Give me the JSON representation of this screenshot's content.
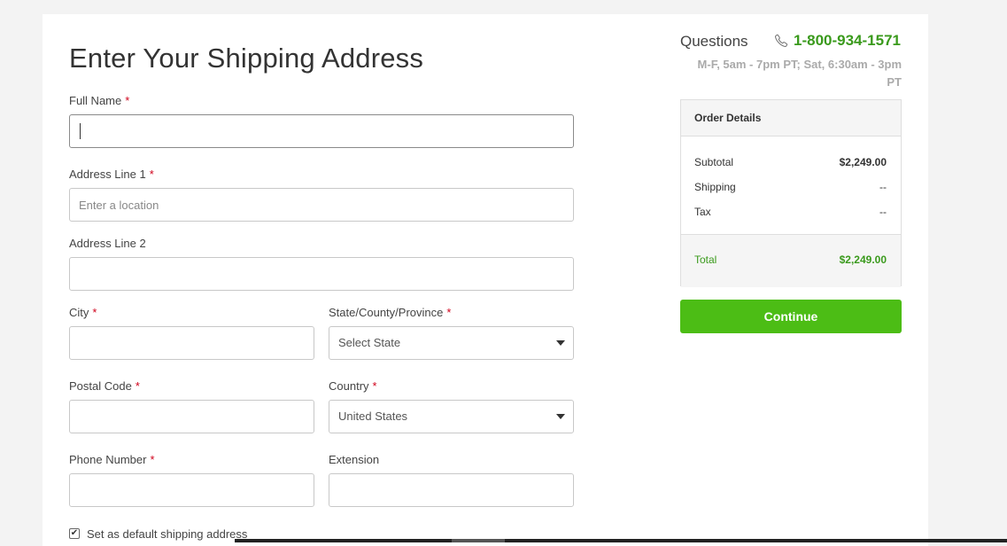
{
  "form": {
    "title": "Enter Your Shipping Address",
    "required_mark": "*",
    "full_name": {
      "label": "Full Name",
      "value": ""
    },
    "address1": {
      "label": "Address Line 1",
      "placeholder": "Enter a location",
      "value": ""
    },
    "address2": {
      "label": "Address Line 2",
      "value": ""
    },
    "city": {
      "label": "City",
      "value": ""
    },
    "state": {
      "label": "State/County/Province",
      "selected": "Select State"
    },
    "postal": {
      "label": "Postal Code",
      "value": ""
    },
    "country": {
      "label": "Country",
      "selected": "United States"
    },
    "phone": {
      "label": "Phone Number",
      "value": ""
    },
    "extension": {
      "label": "Extension",
      "value": ""
    },
    "default_checkbox": {
      "label": "Set as default shipping address",
      "checked": true,
      "check_glyph": "✔"
    }
  },
  "support": {
    "questions_label": "Questions",
    "phone_icon": "phone-icon",
    "phone": "1-800-934-1571",
    "hours": "M-F, 5am - 7pm PT; Sat, 6:30am - 3pm PT"
  },
  "order": {
    "heading": "Order Details",
    "subtotal_label": "Subtotal",
    "subtotal_value": "$2,249.00",
    "shipping_label": "Shipping",
    "shipping_value": "--",
    "tax_label": "Tax",
    "tax_value": "--",
    "total_label": "Total",
    "total_value": "$2,249.00"
  },
  "continue_label": "Continue",
  "colors": {
    "accent_green": "#4cbd15",
    "price_green": "#3a9a1c",
    "required_red": "#d0021b"
  }
}
